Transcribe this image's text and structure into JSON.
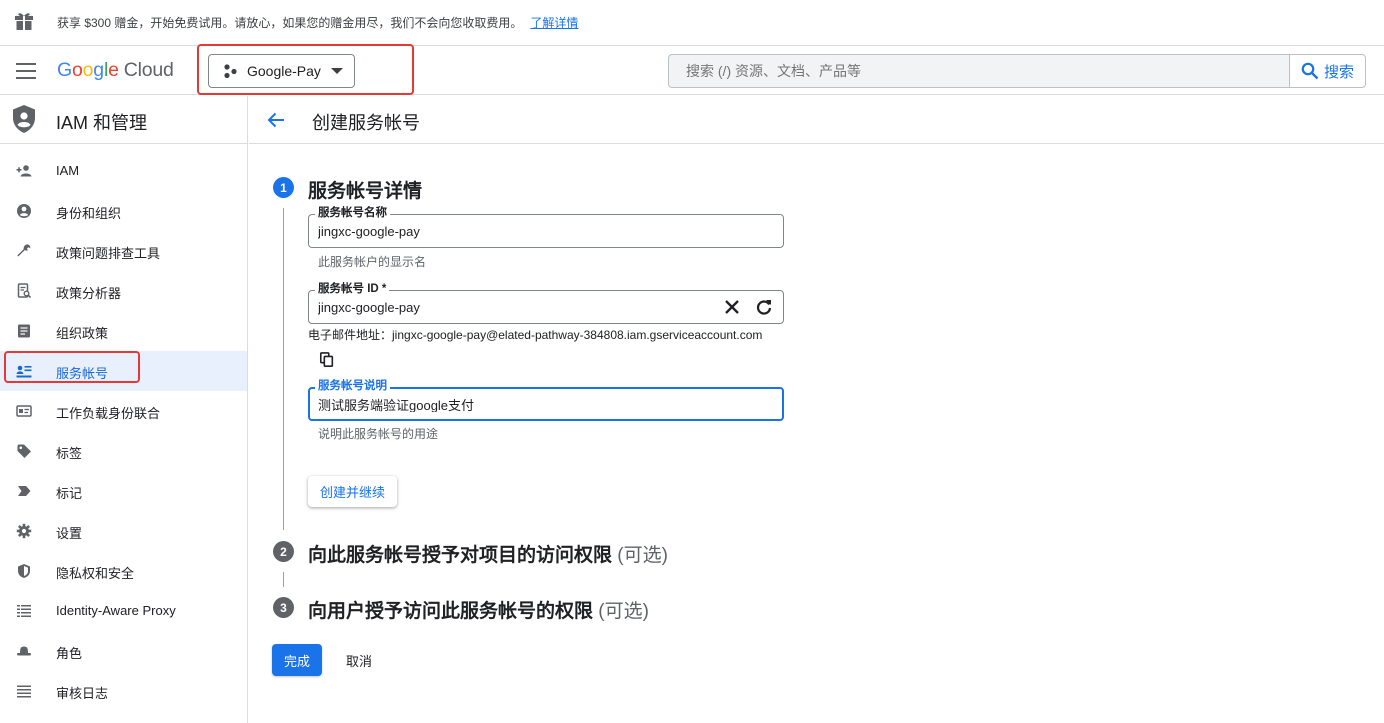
{
  "banner": {
    "icon": "gift-icon",
    "text": "获享 $300 赠金，开始免费试用。请放心，如果您的赠金用尽，我们不会向您收取费用。",
    "link": "了解详情"
  },
  "topbar": {
    "logo": {
      "g1": "G",
      "g2": "o",
      "g3": "o",
      "g4": "g",
      "g5": "l",
      "g6": "e",
      "cloud": "Cloud"
    },
    "project": "Google-Pay",
    "search_placeholder": "搜索 (/) 资源、文档、产品等",
    "search_button": "搜索"
  },
  "sidebar": {
    "title": "IAM 和管理",
    "items": [
      {
        "label": "IAM",
        "icon": "person-add-icon"
      },
      {
        "label": "身份和组织",
        "icon": "account-circle-icon"
      },
      {
        "label": "政策问题排查工具",
        "icon": "wrench-icon"
      },
      {
        "label": "政策分析器",
        "icon": "policy-analyzer-icon"
      },
      {
        "label": "组织政策",
        "icon": "list-doc-icon"
      },
      {
        "label": "服务帐号",
        "icon": "service-account-icon",
        "active": true
      },
      {
        "label": "工作负载身份联合",
        "icon": "id-card-icon"
      },
      {
        "label": "标签",
        "icon": "tag-icon"
      },
      {
        "label": "标记",
        "icon": "label-icon"
      },
      {
        "label": "设置",
        "icon": "gear-icon"
      },
      {
        "label": "隐私权和安全",
        "icon": "shield-icon"
      },
      {
        "label": "Identity-Aware Proxy",
        "icon": "proxy-icon"
      },
      {
        "label": "角色",
        "icon": "hat-icon"
      },
      {
        "label": "审核日志",
        "icon": "list-lines-icon"
      }
    ]
  },
  "main": {
    "title": "创建服务帐号",
    "steps": [
      {
        "num": "1",
        "title": "服务帐号详情",
        "optional": ""
      },
      {
        "num": "2",
        "title": "向此服务帐号授予对项目的访问权限",
        "optional": "(可选)"
      },
      {
        "num": "3",
        "title": "向用户授予访问此服务帐号的权限",
        "optional": "(可选)"
      }
    ],
    "form": {
      "name_label": "服务帐号名称",
      "name_value": "jingxc-google-pay",
      "name_hint": "此服务帐户的显示名",
      "id_label": "服务帐号 ID *",
      "id_value": "jingxc-google-pay",
      "email_prefix": "电子邮件地址：",
      "email": "jingxc-google-pay@elated-pathway-384808.iam.gserviceaccount.com",
      "desc_label": "服务帐号说明",
      "desc_value": "测试服务端验证google支付",
      "desc_hint": "说明此服务帐号的用途",
      "create_button": "创建并继续"
    },
    "done_button": "完成",
    "cancel_button": "取消"
  },
  "colors": {
    "accent": "#1a73e8",
    "highlight_box": "#e53935",
    "active_bg": "#e8f0fe"
  }
}
